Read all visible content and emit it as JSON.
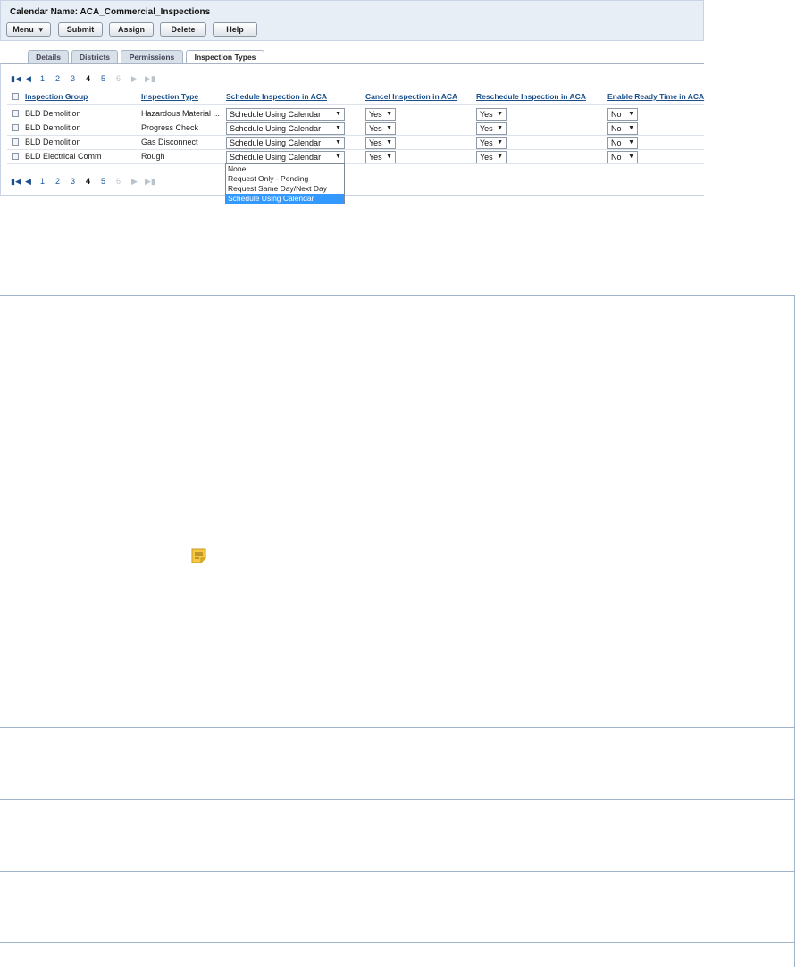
{
  "calendar": {
    "title": "Calendar Name: ACA_Commercial_Inspections"
  },
  "toolbar": {
    "menu_label": "Menu",
    "submit_label": "Submit",
    "assign_label": "Assign",
    "delete_label": "Delete",
    "help_label": "Help"
  },
  "tabs": [
    {
      "label": "Details"
    },
    {
      "label": "Districts"
    },
    {
      "label": "Permissions"
    },
    {
      "label": "Inspection Types",
      "active": true
    }
  ],
  "pager": {
    "pages": [
      "1",
      "2",
      "3",
      "4",
      "5",
      "6"
    ],
    "current": "4"
  },
  "table": {
    "headers": {
      "group": "Inspection Group",
      "type": "Inspection Type",
      "schedule": "Schedule Inspection in ACA",
      "cancel": "Cancel Inspection in ACA",
      "reschedule": "Reschedule Inspection in ACA",
      "ready": "Enable Ready Time in ACA"
    },
    "rows": [
      {
        "group": "BLD Demolition",
        "type": "Hazardous Material ...",
        "schedule": "Schedule Using Calendar",
        "cancel": "Yes",
        "reschedule": "Yes",
        "ready": "No"
      },
      {
        "group": "BLD Demolition",
        "type": "Progress Check",
        "schedule": "Schedule Using Calendar",
        "cancel": "Yes",
        "reschedule": "Yes",
        "ready": "No"
      },
      {
        "group": "BLD Demolition",
        "type": "Gas Disconnect",
        "schedule": "Schedule Using Calendar",
        "cancel": "Yes",
        "reschedule": "Yes",
        "ready": "No"
      },
      {
        "group": "BLD Electrical Comm",
        "type": "Rough",
        "schedule": "Schedule Using Calendar",
        "cancel": "Yes",
        "reschedule": "Yes",
        "ready": "No"
      }
    ]
  },
  "dropdown": {
    "options": [
      "None",
      "Request Only - Pending",
      "Request Same Day/Next Day",
      "Schedule Using Calendar"
    ],
    "highlighted": "Schedule Using Calendar"
  },
  "colors": {
    "link": "#1a4f8a",
    "highlight": "#3399ff",
    "note_icon": "#f5c842"
  },
  "icons": {
    "note": "note-icon"
  }
}
